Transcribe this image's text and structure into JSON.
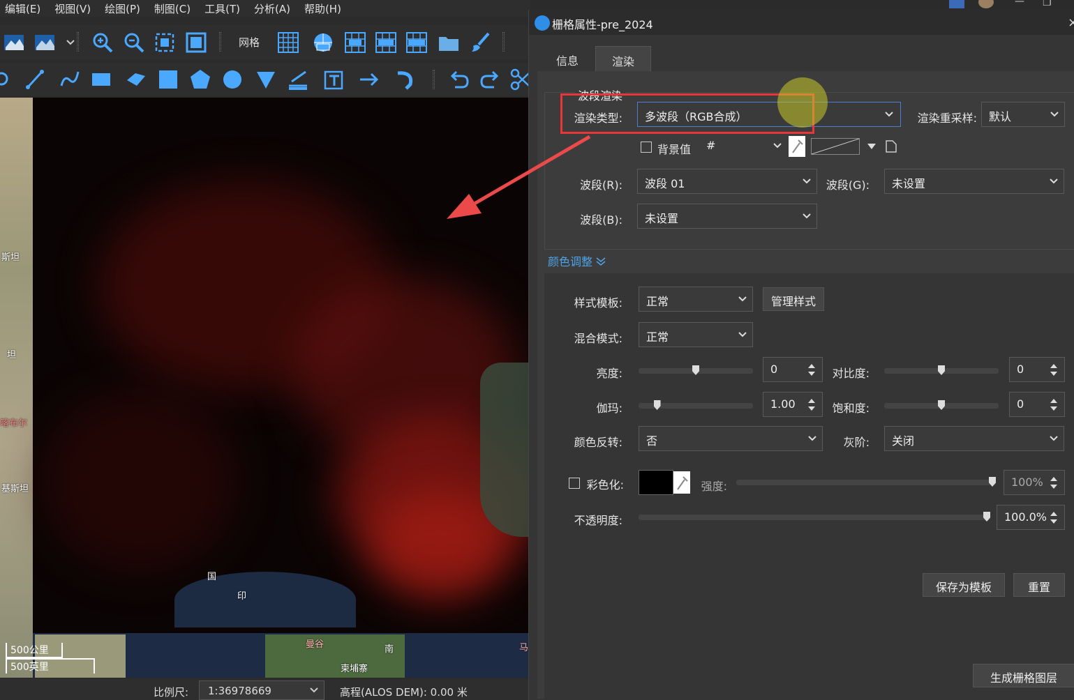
{
  "menubar": {
    "items": [
      "编辑(E)",
      "视图(V)",
      "绘图(P)",
      "制图(C)",
      "工具(T)",
      "分析(A)",
      "帮助(H)"
    ]
  },
  "toolbar": {
    "grid_label": "网格"
  },
  "map": {
    "labels": {
      "tan1": "斯坦",
      "tan2": "坦",
      "kabul": "喀布尔",
      "jisitan": "基斯坦",
      "guo": "国",
      "india": "印",
      "mangu": "曼谷",
      "cambodia": "柬埔寨",
      "nan": "南",
      "ma": "马"
    },
    "scalebar": {
      "km": "500公里",
      "mi": "500英里"
    }
  },
  "statusbar": {
    "scale_label": "比例尺:",
    "scale_value": "1:36978669",
    "elevation": "高程(ALOS DEM): 0.00 米"
  },
  "dialog": {
    "title": "栅格属性-pre_2024",
    "tabs": {
      "info": "信息",
      "render": "渲染"
    },
    "band_render": {
      "title": "波段渲染",
      "render_type_label": "渲染类型:",
      "render_type_value": "多波段（RGB合成）",
      "resample_label": "渲染重采样:",
      "resample_value": "默认",
      "background_label": "背景值",
      "background_value": "#",
      "band_r_label": "波段(R):",
      "band_r_value": "波段 01",
      "band_g_label": "波段(G):",
      "band_g_value": "未设置",
      "band_b_label": "波段(B):",
      "band_b_value": "未设置"
    },
    "color_adjust": {
      "title": "颜色调整",
      "style_template_label": "样式模板:",
      "style_template_value": "正常",
      "manage_style_button": "管理样式",
      "blend_mode_label": "混合模式:",
      "blend_mode_value": "正常",
      "brightness_label": "亮度:",
      "brightness_value": "0",
      "brightness_level": 0.5,
      "contrast_label": "对比度:",
      "contrast_value": "0",
      "contrast_level": 0.5,
      "gamma_label": "伽玛:",
      "gamma_value": "1.00",
      "gamma_level": 0.14,
      "saturation_label": "饱和度:",
      "saturation_value": "0",
      "saturation_level": 0.5,
      "invert_label": "颜色反转:",
      "invert_value": "否",
      "grayscale_label": "灰阶:",
      "grayscale_value": "关闭",
      "colorize_label": "彩色化:",
      "colorize_color": "#000000",
      "strength_label": "强度:",
      "strength_value": "100%",
      "strength_level": 1.0,
      "opacity_label": "不透明度:",
      "opacity_value": "100.0%",
      "opacity_level": 1.0
    },
    "buttons": {
      "save_template": "保存为模板",
      "reset": "重置",
      "generate_raster": "生成栅格图层"
    }
  },
  "colors": {
    "highlight": "#e8363a",
    "link": "#4fa3e8",
    "map_red": "#7a1410"
  }
}
